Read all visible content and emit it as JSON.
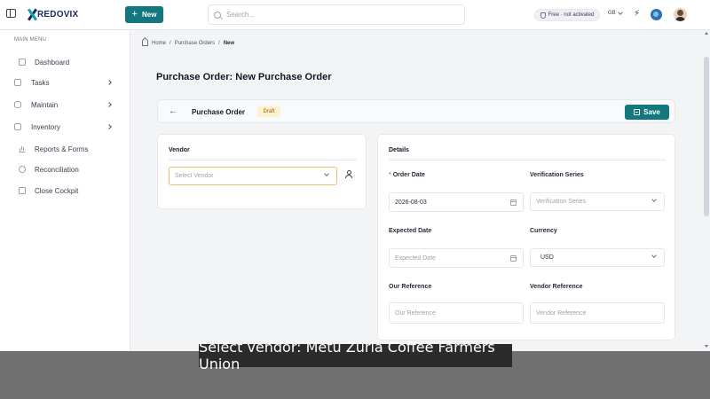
{
  "topbar": {
    "logo_text": "REDOVIX",
    "new_label": "New",
    "search_placeholder": "Search...",
    "plan_badge": "Free · not activated",
    "language": "GB"
  },
  "sidebar": {
    "menu_title": "MAIN MENU",
    "items": [
      {
        "label": "Dashboard",
        "icon": "home-icon",
        "has_children": false
      },
      {
        "label": "Tasks",
        "icon": "checklist-icon",
        "has_children": true
      },
      {
        "label": "Maintain",
        "icon": "database-icon",
        "has_children": true
      },
      {
        "label": "Inventory",
        "icon": "box-icon",
        "has_children": true
      },
      {
        "label": "Reports & Forms",
        "icon": "chart-icon",
        "has_children": false
      },
      {
        "label": "Reconciliation",
        "icon": "check-circle-icon",
        "has_children": false
      },
      {
        "label": "Close Cockpit",
        "icon": "clipboard-icon",
        "has_children": false
      }
    ]
  },
  "breadcrumb": {
    "home": "Home",
    "section": "Purchase Orders",
    "current": "New"
  },
  "page": {
    "title": "Purchase Order: New Purchase Order",
    "titlebar_label": "Purchase Order",
    "status_badge": "Draft",
    "save_label": "Save"
  },
  "vendor": {
    "title": "Vendor",
    "placeholder": "Select Vendor"
  },
  "details": {
    "title": "Details",
    "order_date_label": "Order Date",
    "order_date_value": "2026-08-03",
    "verification_series_label": "Verification Series",
    "verification_series_placeholder": "Verification Series",
    "expected_date_label": "Expected Date",
    "expected_date_placeholder": "Expected Date",
    "currency_label": "Currency",
    "currency_value": "USD",
    "our_reference_label": "Our Reference",
    "our_reference_placeholder": "Our Reference",
    "vendor_reference_label": "Vendor Reference",
    "vendor_reference_placeholder": "Vendor Reference"
  },
  "caption": "Select vendor: Metu Zuria Coffee Farmers Union",
  "colors": {
    "accent": "#12787e",
    "draft_bg": "#fdf2d0",
    "draft_text": "#b45309",
    "focus_border": "#e8c070"
  }
}
